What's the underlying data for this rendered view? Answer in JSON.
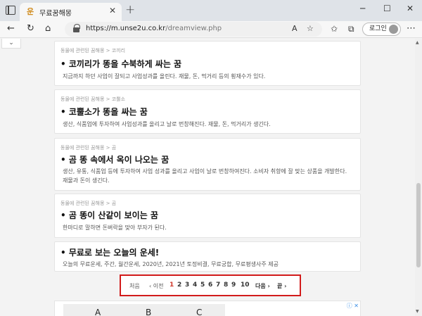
{
  "browser": {
    "tab_title": "무료꿈해몽",
    "favicon": "운",
    "url_host": "https://m.unse2u.co.kr",
    "url_path": "/dreamview.php",
    "login_label": "로그인",
    "read_aloud": "A",
    "icons": [
      "tab-actions-icon",
      "close-icon",
      "plus-icon",
      "minimize-icon",
      "maximize-icon",
      "back-icon",
      "refresh-icon",
      "home-icon",
      "lock-icon",
      "read-aloud-icon",
      "favorite-icon",
      "favorites-icon",
      "collections-icon",
      "profile-icon",
      "more-icon"
    ]
  },
  "cards": [
    {
      "crumb": "동물에 관련된 꿈해몽 > 코끼리",
      "title": "• 코끼리가 똥을 수북하게 싸는 꿈",
      "desc": "지금까지 하던 사업이 잘되고 사업성과를 올린다. 재물, 돈, 먹거리 등의 횡재수가 있다."
    },
    {
      "crumb": "동물에 관련된 꿈해몽 > 코뿔소",
      "title": "• 코뿔소가 똥을 싸는 꿈",
      "desc": "생산, 식품업에 투자하여 사업성과를 올리고 날로 번창해진다. 재물, 돈, 먹거리가 생긴다."
    },
    {
      "crumb": "동물에 관련된 꿈해몽 > 곰",
      "title": "• 곰 똥 속에서 옥이 나오는 꿈",
      "desc": "생산, 유통, 식품업 등에 투자하여 사업 성과를 올리고 사업이 날로 번창하여진다. 소비자 취향에 잘 맞는 상품을 개발한다. 재물과 돈이 생긴다."
    },
    {
      "crumb": "동물에 관련된 꿈해몽 > 곰",
      "title": "• 곰 똥이 산같이 보이는 꿈",
      "desc": "한마디로 말하면 돈벼락을 맞아 부자가 된다."
    }
  ],
  "promo": {
    "title": "• 무료로 보는 오늘의 운세!",
    "desc": "오늘의 무료운세, 주간, 월간운세, 2020년, 2021년 토정비결, 무료궁합, 무료평생사주 제공"
  },
  "pager": {
    "first": "처음",
    "prev": "‹ 이전",
    "pages": [
      "1",
      "2",
      "3",
      "4",
      "5",
      "6",
      "7",
      "8",
      "9",
      "10"
    ],
    "active": "1",
    "next": "다음 ›",
    "last": "끝 ›"
  },
  "ad": {
    "letters": [
      "A",
      "B",
      "C"
    ],
    "mark": "ⓘ ✕"
  },
  "colors": {
    "pager_border": "#d21b1b",
    "active_page": "#d0392c"
  }
}
